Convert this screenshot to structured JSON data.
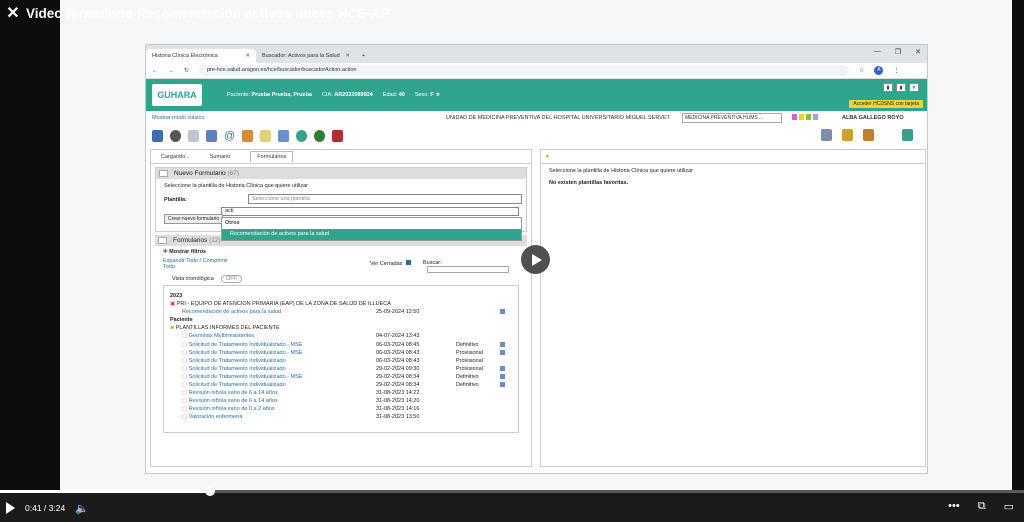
{
  "video": {
    "title": "Video formulario Recomendación activos nueva HCE-AP",
    "current_time": "0:41",
    "duration": "3:24",
    "progress": 0.205
  },
  "browser": {
    "tab1": "Historia Clínica Electrónica",
    "tab2": "Buscador: Activos para la Salud",
    "url": "pre-hce.salud.aragon.es/hce/buscador/buscadorAction.action",
    "profile_letter": "A"
  },
  "app": {
    "logo": "GUHARA",
    "patient_label": "Paciente:",
    "patient_name": "Prueba Prueba, Prueba",
    "cia_label": "CIA:",
    "cia_value": "AR2032089924",
    "age_label": "Edad:",
    "age_value": "40",
    "sex_label": "Sexo:",
    "sex_value": "F",
    "hcdsns": "Acceder HCDSNS con tarjeta",
    "classic_mode": "Mostrar modo clásico",
    "unit": "UNIDAD DE MEDICINA PREVENTIVA DEL HOSPITAL UNIVERSITARIO MIGUEL SERVET",
    "service_select": "MEDICINA PREVENTIVA HUMS ...",
    "user": "ALBA GALLEGO ROYO"
  },
  "left": {
    "tabs": [
      "Cargando...",
      "Sumario",
      "Formularios"
    ],
    "new_form_title": "Nuevo Formulario",
    "new_form_count": "(67)",
    "select_instruction": "Seleccione la plantilla de Historia Clínica que quiere utilizar",
    "plantilla_label": "Plantilla:",
    "plantilla_placeholder": "Seleccione una plantilla",
    "search_value": "acti",
    "create_button": "Crear nuevo formulario",
    "dropdown_group": "Otros",
    "dropdown_item": "Recomendación de activos para la salud",
    "forms_title": "Formularios",
    "forms_count": "(12)",
    "show_filters": "Mostrar filtros",
    "expand_all": "Expandir Todo / Comprimir Todo",
    "ver_cerradas": "Ver Cerradas",
    "buscar": "Buscar:",
    "vista_cronologica": "Vista cronológica",
    "off": "OFF",
    "tree": {
      "year": "2023",
      "group1": "PRI - EQUIPO DE ATENCION PRIMARIA (EAP) DE LA ZONA DE SALUD DE ILLUECA",
      "group1_item": "Recomendación de activos para la salud",
      "group1_date": "25-09-2024 12:50",
      "paciente_label": "Paciente",
      "group2": "PLANTILLAS INFORMES DEL PACIENTE",
      "rows": [
        {
          "name": "Germinas Multirresistentes",
          "date": "04-07-2024 13:43",
          "state": ""
        },
        {
          "name": "Solicitud de Tratamiento Individualizado - MSE",
          "date": "06-03-2024 08:45",
          "state": "Definitivo"
        },
        {
          "name": "Solicitud de Tratamiento Individualizado - MSE",
          "date": "06-03-2024 08:43",
          "state": "Provisional"
        },
        {
          "name": "Solicitud de Tratamiento Individualizado",
          "date": "06-03-2024 08:43",
          "state": "Provisional"
        },
        {
          "name": "Solicitud de Tratamiento Individualizado",
          "date": "29-02-2024 09:30",
          "state": "Provisional"
        },
        {
          "name": "Solicitud de Tratamiento Individualizado - MSE",
          "date": "29-02-2024 08:34",
          "state": "Definitivo"
        },
        {
          "name": "Solicitud de Tratamiento Individualizado",
          "date": "29-02-2024 08:34",
          "state": "Definitivo"
        },
        {
          "name": "Revisión niño/a sano de 6 a 14 años",
          "date": "31-08-2023 14:22",
          "state": ""
        },
        {
          "name": "Revisión niño/a sano de 6 a 14 años",
          "date": "31-08-2023 14:20",
          "state": ""
        },
        {
          "name": "Revisión niño/a sano de 0 a 2 años",
          "date": "31-08-2023 14:16",
          "state": ""
        },
        {
          "name": "Valoración enfermería",
          "date": "31-08-2023 13:50",
          "state": ""
        }
      ]
    }
  },
  "right": {
    "instruction": "Seleccione la plantilla de Historia Clínica que quiere utilizar",
    "no_favorites": "No existen plantillas favoritas."
  }
}
